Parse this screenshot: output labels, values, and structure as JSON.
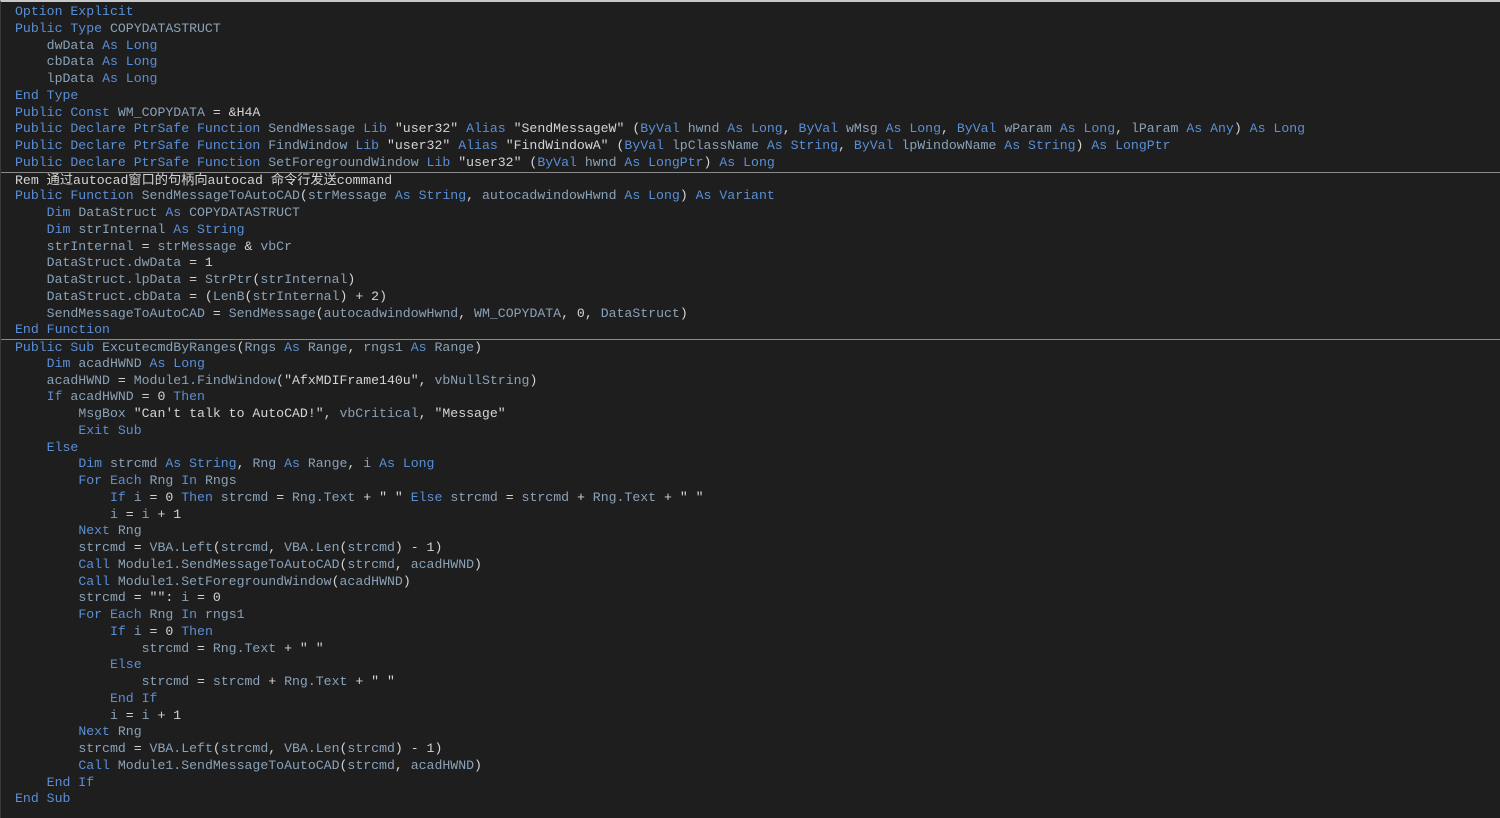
{
  "colors": {
    "background": "#1e1e1e",
    "keyword": "#5a8fd6",
    "identifier": "#8aa2b8",
    "string": "#d4d4d4",
    "separator": "#8a8a8a"
  },
  "lines": [
    {
      "sep": false,
      "tokens": [
        [
          "kw",
          "Option Explicit"
        ]
      ]
    },
    {
      "sep": false,
      "tokens": [
        [
          "kw",
          "Public Type "
        ],
        [
          "id",
          "COPYDATASTRUCT"
        ]
      ]
    },
    {
      "sep": false,
      "tokens": [
        [
          "pl",
          "    "
        ],
        [
          "id",
          "dwData "
        ],
        [
          "kw",
          "As Long"
        ]
      ]
    },
    {
      "sep": false,
      "tokens": [
        [
          "pl",
          "    "
        ],
        [
          "id",
          "cbData "
        ],
        [
          "kw",
          "As Long"
        ]
      ]
    },
    {
      "sep": false,
      "tokens": [
        [
          "pl",
          "    "
        ],
        [
          "id",
          "lpData "
        ],
        [
          "kw",
          "As Long"
        ]
      ]
    },
    {
      "sep": false,
      "tokens": [
        [
          "kw",
          "End Type"
        ]
      ]
    },
    {
      "sep": false,
      "tokens": [
        [
          "kw",
          "Public Const "
        ],
        [
          "id",
          "WM_COPYDATA "
        ],
        [
          "op",
          "= &H4A"
        ]
      ]
    },
    {
      "sep": false,
      "tokens": [
        [
          "kw",
          "Public Declare PtrSafe Function "
        ],
        [
          "id",
          "SendMessage "
        ],
        [
          "kw",
          "Lib "
        ],
        [
          "str",
          "\"user32\" "
        ],
        [
          "kw",
          "Alias "
        ],
        [
          "str",
          "\"SendMessageW\" "
        ],
        [
          "op",
          "("
        ],
        [
          "kw",
          "ByVal "
        ],
        [
          "id",
          "hwnd "
        ],
        [
          "kw",
          "As Long"
        ],
        [
          "op",
          ", "
        ],
        [
          "kw",
          "ByVal "
        ],
        [
          "id",
          "wMsg "
        ],
        [
          "kw",
          "As Long"
        ],
        [
          "op",
          ", "
        ],
        [
          "kw",
          "ByVal "
        ],
        [
          "id",
          "wParam "
        ],
        [
          "kw",
          "As Long"
        ],
        [
          "op",
          ", "
        ],
        [
          "id",
          "lParam "
        ],
        [
          "kw",
          "As Any"
        ],
        [
          "op",
          ") "
        ],
        [
          "kw",
          "As Long"
        ]
      ]
    },
    {
      "sep": false,
      "tokens": [
        [
          "kw",
          "Public Declare PtrSafe Function "
        ],
        [
          "id",
          "FindWindow "
        ],
        [
          "kw",
          "Lib "
        ],
        [
          "str",
          "\"user32\" "
        ],
        [
          "kw",
          "Alias "
        ],
        [
          "str",
          "\"FindWindowA\" "
        ],
        [
          "op",
          "("
        ],
        [
          "kw",
          "ByVal "
        ],
        [
          "id",
          "lpClassName "
        ],
        [
          "kw",
          "As String"
        ],
        [
          "op",
          ", "
        ],
        [
          "kw",
          "ByVal "
        ],
        [
          "id",
          "lpWindowName "
        ],
        [
          "kw",
          "As String"
        ],
        [
          "op",
          ") "
        ],
        [
          "kw",
          "As LongPtr"
        ]
      ]
    },
    {
      "sep": false,
      "tokens": [
        [
          "kw",
          "Public Declare PtrSafe Function "
        ],
        [
          "id",
          "SetForegroundWindow "
        ],
        [
          "kw",
          "Lib "
        ],
        [
          "str",
          "\"user32\" "
        ],
        [
          "op",
          "("
        ],
        [
          "kw",
          "ByVal "
        ],
        [
          "id",
          "hwnd "
        ],
        [
          "kw",
          "As LongPtr"
        ],
        [
          "op",
          ") "
        ],
        [
          "kw",
          "As Long"
        ]
      ]
    },
    {
      "sep": true,
      "tokens": [
        [
          "cmt",
          "Rem 通过autocad窗口的句柄向autocad 命令行发送command"
        ]
      ]
    },
    {
      "sep": false,
      "tokens": [
        [
          "kw",
          "Public Function "
        ],
        [
          "id",
          "SendMessageToAutoCAD"
        ],
        [
          "op",
          "("
        ],
        [
          "id",
          "strMessage "
        ],
        [
          "kw",
          "As String"
        ],
        [
          "op",
          ", "
        ],
        [
          "id",
          "autocadwindowHwnd "
        ],
        [
          "kw",
          "As Long"
        ],
        [
          "op",
          ") "
        ],
        [
          "kw",
          "As Variant"
        ]
      ]
    },
    {
      "sep": false,
      "tokens": [
        [
          "pl",
          "    "
        ],
        [
          "kw",
          "Dim "
        ],
        [
          "id",
          "DataStruct "
        ],
        [
          "kw",
          "As "
        ],
        [
          "id",
          "COPYDATASTRUCT"
        ]
      ]
    },
    {
      "sep": false,
      "tokens": [
        [
          "pl",
          "    "
        ],
        [
          "kw",
          "Dim "
        ],
        [
          "id",
          "strInternal "
        ],
        [
          "kw",
          "As String"
        ]
      ]
    },
    {
      "sep": false,
      "tokens": [
        [
          "pl",
          "    "
        ],
        [
          "id",
          "strInternal "
        ],
        [
          "op",
          "= "
        ],
        [
          "id",
          "strMessage "
        ],
        [
          "op",
          "& "
        ],
        [
          "id",
          "vbCr"
        ]
      ]
    },
    {
      "sep": false,
      "tokens": [
        [
          "pl",
          "    "
        ],
        [
          "id",
          "DataStruct.dwData "
        ],
        [
          "op",
          "= 1"
        ]
      ]
    },
    {
      "sep": false,
      "tokens": [
        [
          "pl",
          "    "
        ],
        [
          "id",
          "DataStruct.lpData "
        ],
        [
          "op",
          "= "
        ],
        [
          "id",
          "StrPtr"
        ],
        [
          "op",
          "("
        ],
        [
          "id",
          "strInternal"
        ],
        [
          "op",
          ")"
        ]
      ]
    },
    {
      "sep": false,
      "tokens": [
        [
          "pl",
          "    "
        ],
        [
          "id",
          "DataStruct.cbData "
        ],
        [
          "op",
          "= ("
        ],
        [
          "id",
          "LenB"
        ],
        [
          "op",
          "("
        ],
        [
          "id",
          "strInternal"
        ],
        [
          "op",
          ") + 2)"
        ]
      ]
    },
    {
      "sep": false,
      "tokens": [
        [
          "pl",
          "    "
        ],
        [
          "id",
          "SendMessageToAutoCAD "
        ],
        [
          "op",
          "= "
        ],
        [
          "id",
          "SendMessage"
        ],
        [
          "op",
          "("
        ],
        [
          "id",
          "autocadwindowHwnd"
        ],
        [
          "op",
          ", "
        ],
        [
          "id",
          "WM_COPYDATA"
        ],
        [
          "op",
          ", 0, "
        ],
        [
          "id",
          "DataStruct"
        ],
        [
          "op",
          ")"
        ]
      ]
    },
    {
      "sep": false,
      "tokens": [
        [
          "kw",
          "End Function"
        ]
      ]
    },
    {
      "sep": true,
      "tokens": [
        [
          "kw",
          "Public Sub "
        ],
        [
          "id",
          "ExcutecmdByRanges"
        ],
        [
          "op",
          "("
        ],
        [
          "id",
          "Rngs "
        ],
        [
          "kw",
          "As "
        ],
        [
          "id",
          "Range"
        ],
        [
          "op",
          ", "
        ],
        [
          "id",
          "rngs1 "
        ],
        [
          "kw",
          "As "
        ],
        [
          "id",
          "Range"
        ],
        [
          "op",
          ")"
        ]
      ]
    },
    {
      "sep": false,
      "tokens": [
        [
          "pl",
          "    "
        ],
        [
          "kw",
          "Dim "
        ],
        [
          "id",
          "acadHWND "
        ],
        [
          "kw",
          "As Long"
        ]
      ]
    },
    {
      "sep": false,
      "tokens": [
        [
          "pl",
          "    "
        ],
        [
          "id",
          "acadHWND "
        ],
        [
          "op",
          "= "
        ],
        [
          "id",
          "Module1.FindWindow"
        ],
        [
          "op",
          "("
        ],
        [
          "str",
          "\"AfxMDIFrame140u\""
        ],
        [
          "op",
          ", "
        ],
        [
          "id",
          "vbNullString"
        ],
        [
          "op",
          ")"
        ]
      ]
    },
    {
      "sep": false,
      "tokens": [
        [
          "pl",
          "    "
        ],
        [
          "kw",
          "If "
        ],
        [
          "id",
          "acadHWND "
        ],
        [
          "op",
          "= 0 "
        ],
        [
          "kw",
          "Then"
        ]
      ]
    },
    {
      "sep": false,
      "tokens": [
        [
          "pl",
          "        "
        ],
        [
          "id",
          "MsgBox "
        ],
        [
          "str",
          "\"Can't talk to AutoCAD!\""
        ],
        [
          "op",
          ", "
        ],
        [
          "id",
          "vbCritical"
        ],
        [
          "op",
          ", "
        ],
        [
          "str",
          "\"Message\""
        ]
      ]
    },
    {
      "sep": false,
      "tokens": [
        [
          "pl",
          "        "
        ],
        [
          "kw",
          "Exit Sub"
        ]
      ]
    },
    {
      "sep": false,
      "tokens": [
        [
          "pl",
          "    "
        ],
        [
          "kw",
          "Else"
        ]
      ]
    },
    {
      "sep": false,
      "tokens": [
        [
          "pl",
          "        "
        ],
        [
          "kw",
          "Dim "
        ],
        [
          "id",
          "strcmd "
        ],
        [
          "kw",
          "As String"
        ],
        [
          "op",
          ", "
        ],
        [
          "id",
          "Rng "
        ],
        [
          "kw",
          "As "
        ],
        [
          "id",
          "Range"
        ],
        [
          "op",
          ", "
        ],
        [
          "id",
          "i "
        ],
        [
          "kw",
          "As Long"
        ]
      ]
    },
    {
      "sep": false,
      "tokens": [
        [
          "pl",
          "        "
        ],
        [
          "kw",
          "For Each "
        ],
        [
          "id",
          "Rng "
        ],
        [
          "kw",
          "In "
        ],
        [
          "id",
          "Rngs"
        ]
      ]
    },
    {
      "sep": false,
      "tokens": [
        [
          "pl",
          "            "
        ],
        [
          "kw",
          "If "
        ],
        [
          "id",
          "i "
        ],
        [
          "op",
          "= 0 "
        ],
        [
          "kw",
          "Then "
        ],
        [
          "id",
          "strcmd "
        ],
        [
          "op",
          "= "
        ],
        [
          "id",
          "Rng.Text "
        ],
        [
          "op",
          "+ "
        ],
        [
          "str",
          "\" \" "
        ],
        [
          "kw",
          "Else "
        ],
        [
          "id",
          "strcmd "
        ],
        [
          "op",
          "= "
        ],
        [
          "id",
          "strcmd "
        ],
        [
          "op",
          "+ "
        ],
        [
          "id",
          "Rng.Text "
        ],
        [
          "op",
          "+ "
        ],
        [
          "str",
          "\" \""
        ]
      ]
    },
    {
      "sep": false,
      "tokens": [
        [
          "pl",
          "            "
        ],
        [
          "id",
          "i "
        ],
        [
          "op",
          "= "
        ],
        [
          "id",
          "i "
        ],
        [
          "op",
          "+ 1"
        ]
      ]
    },
    {
      "sep": false,
      "tokens": [
        [
          "pl",
          "        "
        ],
        [
          "kw",
          "Next "
        ],
        [
          "id",
          "Rng"
        ]
      ]
    },
    {
      "sep": false,
      "tokens": [
        [
          "pl",
          "        "
        ],
        [
          "id",
          "strcmd "
        ],
        [
          "op",
          "= "
        ],
        [
          "id",
          "VBA.Left"
        ],
        [
          "op",
          "("
        ],
        [
          "id",
          "strcmd"
        ],
        [
          "op",
          ", "
        ],
        [
          "id",
          "VBA.Len"
        ],
        [
          "op",
          "("
        ],
        [
          "id",
          "strcmd"
        ],
        [
          "op",
          ") - 1)"
        ]
      ]
    },
    {
      "sep": false,
      "tokens": [
        [
          "pl",
          "        "
        ],
        [
          "kw",
          "Call "
        ],
        [
          "id",
          "Module1.SendMessageToAutoCAD"
        ],
        [
          "op",
          "("
        ],
        [
          "id",
          "strcmd"
        ],
        [
          "op",
          ", "
        ],
        [
          "id",
          "acadHWND"
        ],
        [
          "op",
          ")"
        ]
      ]
    },
    {
      "sep": false,
      "tokens": [
        [
          "pl",
          "        "
        ],
        [
          "kw",
          "Call "
        ],
        [
          "id",
          "Module1.SetForegroundWindow"
        ],
        [
          "op",
          "("
        ],
        [
          "id",
          "acadHWND"
        ],
        [
          "op",
          ")"
        ]
      ]
    },
    {
      "sep": false,
      "tokens": [
        [
          "pl",
          "        "
        ],
        [
          "id",
          "strcmd "
        ],
        [
          "op",
          "= "
        ],
        [
          "str",
          "\"\""
        ],
        [
          "op",
          ": "
        ],
        [
          "id",
          "i "
        ],
        [
          "op",
          "= 0"
        ]
      ]
    },
    {
      "sep": false,
      "tokens": [
        [
          "pl",
          "        "
        ],
        [
          "kw",
          "For Each "
        ],
        [
          "id",
          "Rng "
        ],
        [
          "kw",
          "In "
        ],
        [
          "id",
          "rngs1"
        ]
      ]
    },
    {
      "sep": false,
      "tokens": [
        [
          "pl",
          "            "
        ],
        [
          "kw",
          "If "
        ],
        [
          "id",
          "i "
        ],
        [
          "op",
          "= 0 "
        ],
        [
          "kw",
          "Then"
        ]
      ]
    },
    {
      "sep": false,
      "tokens": [
        [
          "pl",
          "                "
        ],
        [
          "id",
          "strcmd "
        ],
        [
          "op",
          "= "
        ],
        [
          "id",
          "Rng.Text "
        ],
        [
          "op",
          "+ "
        ],
        [
          "str",
          "\" \""
        ]
      ]
    },
    {
      "sep": false,
      "tokens": [
        [
          "pl",
          "            "
        ],
        [
          "kw",
          "Else"
        ]
      ]
    },
    {
      "sep": false,
      "tokens": [
        [
          "pl",
          "                "
        ],
        [
          "id",
          "strcmd "
        ],
        [
          "op",
          "= "
        ],
        [
          "id",
          "strcmd "
        ],
        [
          "op",
          "+ "
        ],
        [
          "id",
          "Rng.Text "
        ],
        [
          "op",
          "+ "
        ],
        [
          "str",
          "\" \""
        ]
      ]
    },
    {
      "sep": false,
      "tokens": [
        [
          "pl",
          "            "
        ],
        [
          "kw",
          "End If"
        ]
      ]
    },
    {
      "sep": false,
      "tokens": [
        [
          "pl",
          "            "
        ],
        [
          "id",
          "i "
        ],
        [
          "op",
          "= "
        ],
        [
          "id",
          "i "
        ],
        [
          "op",
          "+ 1"
        ]
      ]
    },
    {
      "sep": false,
      "tokens": [
        [
          "pl",
          "        "
        ],
        [
          "kw",
          "Next "
        ],
        [
          "id",
          "Rng"
        ]
      ]
    },
    {
      "sep": false,
      "tokens": [
        [
          "pl",
          "        "
        ],
        [
          "id",
          "strcmd "
        ],
        [
          "op",
          "= "
        ],
        [
          "id",
          "VBA.Left"
        ],
        [
          "op",
          "("
        ],
        [
          "id",
          "strcmd"
        ],
        [
          "op",
          ", "
        ],
        [
          "id",
          "VBA.Len"
        ],
        [
          "op",
          "("
        ],
        [
          "id",
          "strcmd"
        ],
        [
          "op",
          ") - 1)"
        ]
      ]
    },
    {
      "sep": false,
      "tokens": [
        [
          "pl",
          "        "
        ],
        [
          "kw",
          "Call "
        ],
        [
          "id",
          "Module1.SendMessageToAutoCAD"
        ],
        [
          "op",
          "("
        ],
        [
          "id",
          "strcmd"
        ],
        [
          "op",
          ", "
        ],
        [
          "id",
          "acadHWND"
        ],
        [
          "op",
          ")"
        ]
      ]
    },
    {
      "sep": false,
      "tokens": [
        [
          "pl",
          "    "
        ],
        [
          "kw",
          "End If"
        ]
      ]
    },
    {
      "sep": false,
      "tokens": [
        [
          "kw",
          "End Sub"
        ]
      ]
    }
  ]
}
